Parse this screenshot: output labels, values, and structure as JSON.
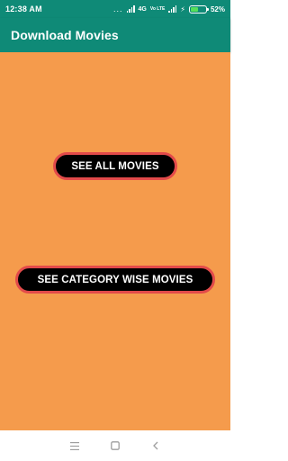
{
  "status_bar": {
    "time": "12:38 AM",
    "dots": "...",
    "network": "4G",
    "volte": "Vo LTE",
    "battery_percent": "52%",
    "battery_level": 0.52
  },
  "app_bar": {
    "title": "Download Movies"
  },
  "main": {
    "background_color": "#f59b4c",
    "buttons": {
      "all_movies": "SEE ALL MOVIES",
      "category_movies": "SEE CATEGORY WISE MOVIES"
    }
  },
  "nav_bar": {
    "icons": [
      "menu-icon",
      "home-square-icon",
      "back-chevron-icon"
    ]
  },
  "colors": {
    "primary": "#0f8a77",
    "button_bg": "#000000",
    "button_border": "#e24a4a"
  }
}
